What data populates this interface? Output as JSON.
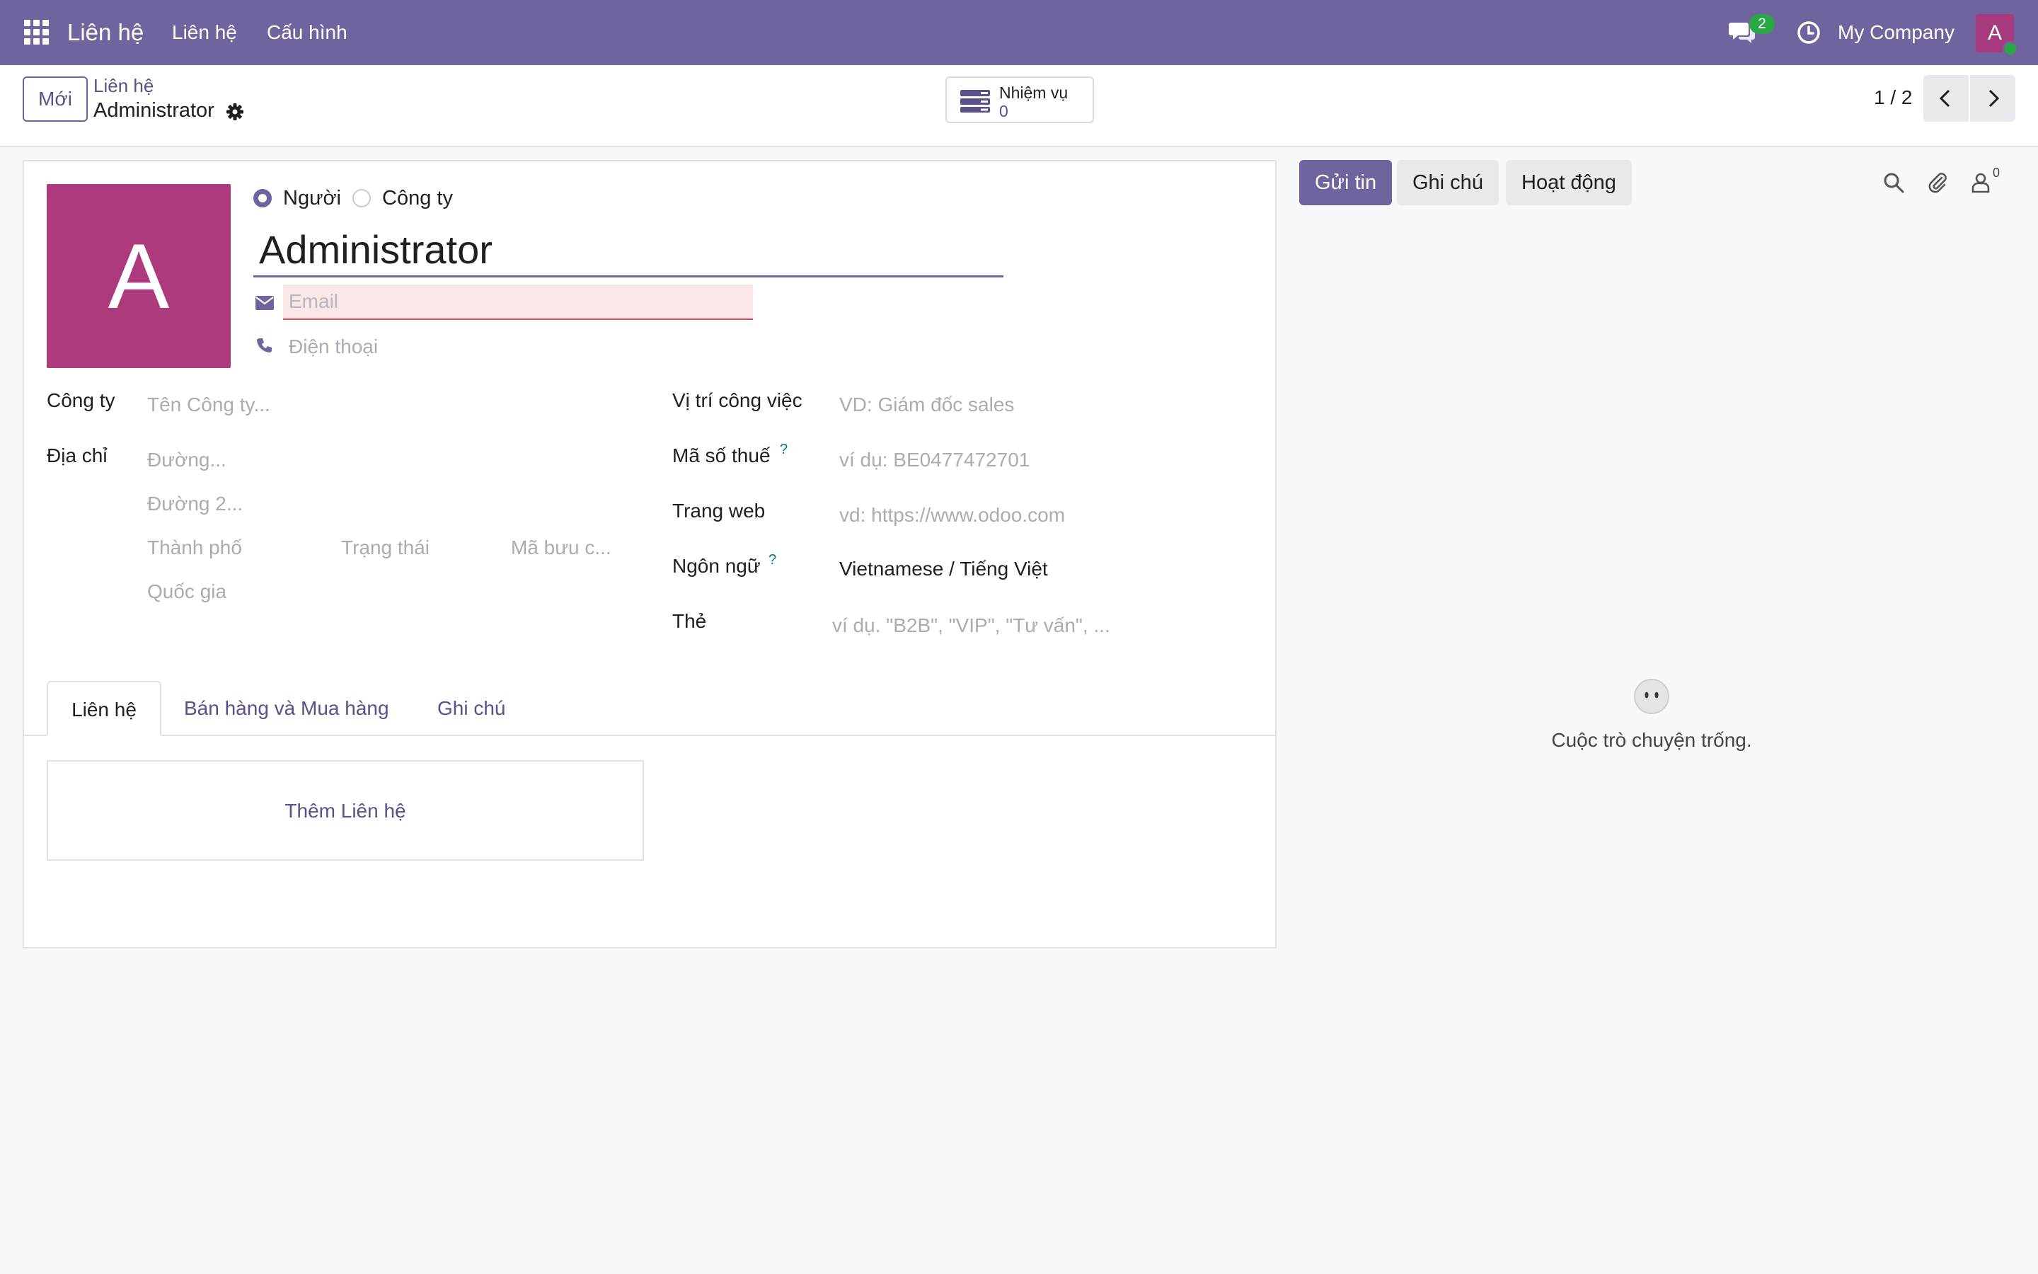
{
  "navbar": {
    "app_name": "Liên hệ",
    "menu": [
      "Liên hệ",
      "Cấu hình"
    ],
    "message_count": "2",
    "company": "My Company",
    "user_initial": "A"
  },
  "control_panel": {
    "new_label": "Mới",
    "breadcrumb_parent": "Liên hệ",
    "breadcrumb_current": "Administrator",
    "task_label": "Nhiệm vụ",
    "task_count": "0",
    "pager": "1 / 2"
  },
  "form": {
    "avatar_initial": "A",
    "type_person": "Người",
    "type_company": "Công ty",
    "name": "Administrator",
    "email_placeholder": "Email",
    "phone_placeholder": "Điện thoại",
    "company_label": "Công ty",
    "company_placeholder": "Tên Công ty...",
    "address_label": "Địa chỉ",
    "street_placeholder": "Đường...",
    "street2_placeholder": "Đường 2...",
    "city_placeholder": "Thành phố",
    "state_placeholder": "Trạng thái",
    "zip_placeholder": "Mã bưu c...",
    "country_placeholder": "Quốc gia",
    "job_label": "Vị trí công việc",
    "job_placeholder": "VD: Giám đốc sales",
    "vat_label": "Mã số thuế",
    "vat_placeholder": "ví dụ: BE0477472701",
    "website_label": "Trang web",
    "website_placeholder": "vd: https://www.odoo.com",
    "lang_label": "Ngôn ngữ",
    "lang_value": "Vietnamese / Tiếng Việt",
    "tags_label": "Thẻ",
    "tags_placeholder": "ví dụ. \"B2B\", \"VIP\", \"Tư vấn\", ...",
    "help_mark": "?"
  },
  "tabs": [
    "Liên hệ",
    "Bán hàng và Mua hàng",
    "Ghi chú"
  ],
  "add_contact_label": "Thêm Liên hệ",
  "chatter": {
    "send_label": "Gửi tin",
    "note_label": "Ghi chú",
    "activity_label": "Hoạt động",
    "follower_count": "0",
    "empty_text": "Cuộc trò chuyện trống."
  },
  "colors": {
    "brand": "#71639e",
    "avatar": "#ad3a7c",
    "success": "#28a745",
    "invalid": "#d44c59"
  }
}
